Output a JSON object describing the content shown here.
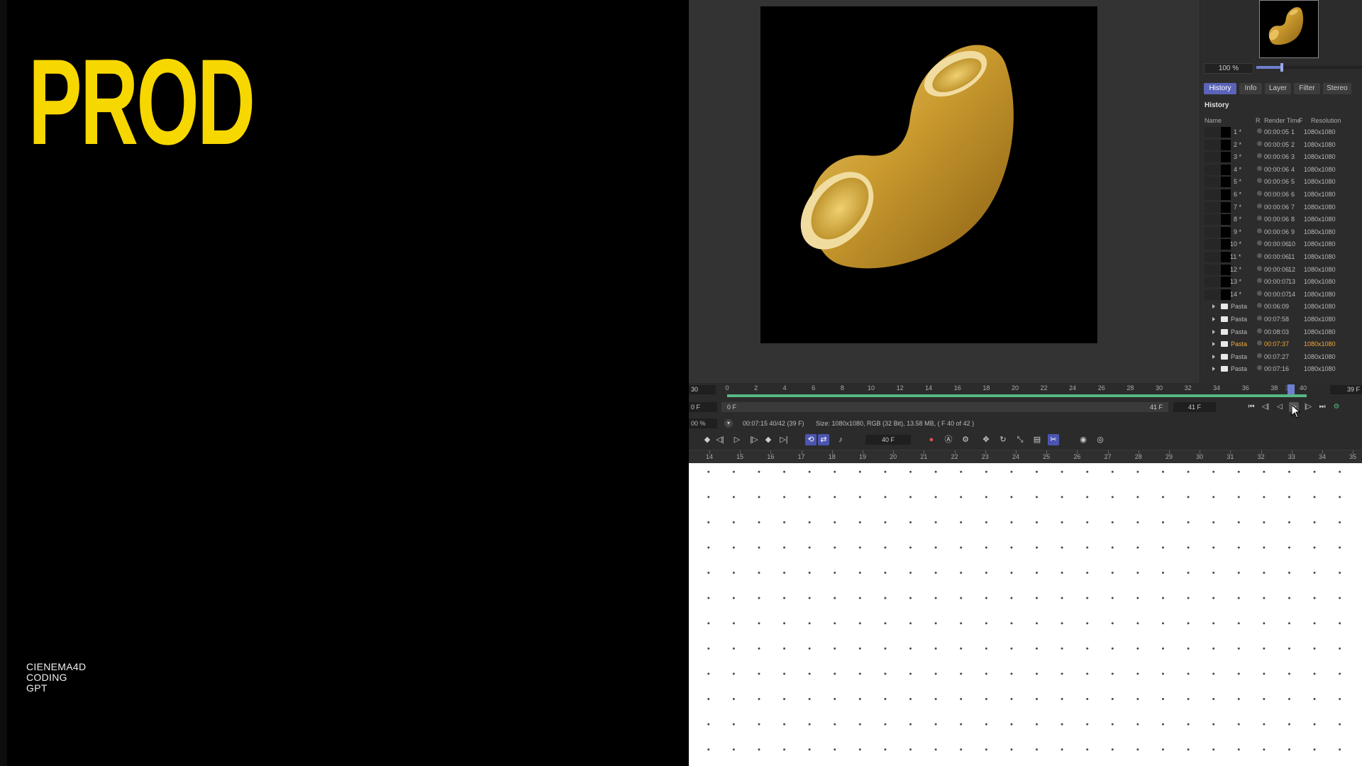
{
  "left": {
    "title": "PROD",
    "tags": [
      "CIENEMA4D",
      "CODING",
      "GPT"
    ]
  },
  "side_panel": {
    "zoom": "100 %",
    "zoom_slider_fraction": 0.24,
    "tabs": [
      "History",
      "Info",
      "Layer",
      "Filter",
      "Stereo"
    ],
    "active_tab": "History",
    "section_label": "History",
    "columns": [
      "Name",
      "R",
      "Render Time",
      "F",
      "Resolution"
    ],
    "rows": [
      {
        "name": "1 *",
        "time": "00:00:05",
        "frame": "1",
        "res": "1080x1080"
      },
      {
        "name": "2 *",
        "time": "00:00:05",
        "frame": "2",
        "res": "1080x1080"
      },
      {
        "name": "3 *",
        "time": "00:00:06",
        "frame": "3",
        "res": "1080x1080"
      },
      {
        "name": "4 *",
        "time": "00:00:06",
        "frame": "4",
        "res": "1080x1080"
      },
      {
        "name": "5 *",
        "time": "00:00:06",
        "frame": "5",
        "res": "1080x1080"
      },
      {
        "name": "6 *",
        "time": "00:00:06",
        "frame": "6",
        "res": "1080x1080"
      },
      {
        "name": "7 *",
        "time": "00:00:06",
        "frame": "7",
        "res": "1080x1080"
      },
      {
        "name": "8 *",
        "time": "00:00:06",
        "frame": "8",
        "res": "1080x1080"
      },
      {
        "name": "9 *",
        "time": "00:00:06",
        "frame": "9",
        "res": "1080x1080"
      },
      {
        "name": "10 *",
        "time": "00:00:06",
        "frame": "10",
        "res": "1080x1080"
      },
      {
        "name": "11 *",
        "time": "00:00:06",
        "frame": "11",
        "res": "1080x1080"
      },
      {
        "name": "12 *",
        "time": "00:00:06",
        "frame": "12",
        "res": "1080x1080"
      },
      {
        "name": "13 *",
        "time": "00:00:07",
        "frame": "13",
        "res": "1080x1080"
      },
      {
        "name": "14 *",
        "time": "00:00:07",
        "frame": "14",
        "res": "1080x1080"
      }
    ],
    "folders": [
      {
        "name": "Pasta",
        "time": "00:06:09",
        "res": "1080x1080",
        "highlight": false
      },
      {
        "name": "Pasta",
        "time": "00:07:58",
        "res": "1080x1080",
        "highlight": false
      },
      {
        "name": "Pasta",
        "time": "00:08:03",
        "res": "1080x1080",
        "highlight": false
      },
      {
        "name": "Pasta",
        "time": "00:07:37",
        "res": "1080x1080",
        "highlight": true
      },
      {
        "name": "Pasta",
        "time": "00:07:27",
        "res": "1080x1080",
        "highlight": false
      },
      {
        "name": "Pasta",
        "time": "00:07:16",
        "res": "1080x1080",
        "highlight": false
      }
    ]
  },
  "timeline": {
    "start_box": "30",
    "end_box": "39 F",
    "top_ticks": [
      "0",
      "2",
      "4",
      "6",
      "8",
      "10",
      "12",
      "14",
      "16",
      "18",
      "20",
      "22",
      "24",
      "26",
      "28",
      "30",
      "32",
      "34",
      "36",
      "38",
      "39",
      "40"
    ],
    "range_min": "0 F",
    "range_start": "0 F",
    "range_end": "41 F",
    "range_max": "41 F",
    "status_zoom": "00 %",
    "status_time": "00:07:15 40/42 (39 F)",
    "status_size": "Size: 1080x1080, RGB (32 Bit), 13.58 MB,  ( F 40 of 42 )",
    "fps": "40 F",
    "bottom_ticks": [
      "14",
      "15",
      "16",
      "17",
      "18",
      "19",
      "20",
      "21",
      "22",
      "23",
      "24",
      "25",
      "26",
      "27",
      "28",
      "29",
      "30",
      "31",
      "32",
      "33",
      "34",
      "35"
    ]
  },
  "colors": {
    "title_yellow": "#f7d700",
    "accent_blue": "#5b64b8",
    "progress_green": "#57b883",
    "highlight_orange": "#f0a83a"
  }
}
